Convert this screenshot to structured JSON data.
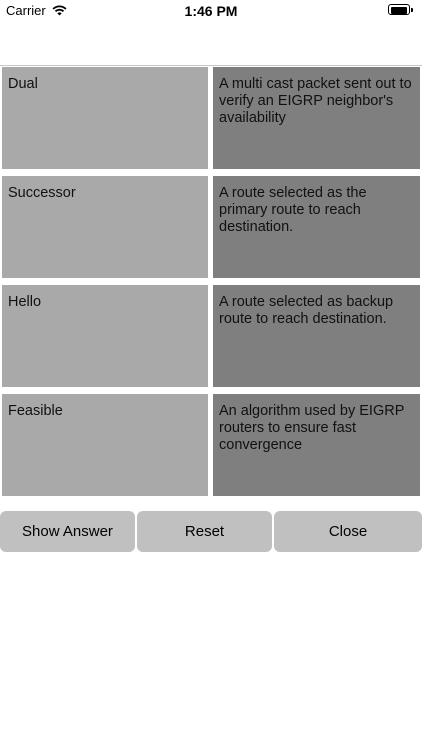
{
  "status_bar": {
    "carrier": "Carrier",
    "time": "1:46 PM"
  },
  "rows": [
    {
      "term": "Dual",
      "definition": "A multi cast packet sent out to verify an EIGRP neighbor's availability"
    },
    {
      "term": "Successor",
      "definition": "A route selected as the primary route to reach destination."
    },
    {
      "term": "Hello",
      "definition": "A route selected as backup route to reach destination."
    },
    {
      "term": "Feasible",
      "definition": "An algorithm used by EIGRP routers to ensure fast convergence"
    }
  ],
  "buttons": {
    "show_answer": "Show Answer",
    "reset": "Reset",
    "close": "Close"
  },
  "colors": {
    "term_bg": "#a9a9a9",
    "definition_bg": "#7f7f7f",
    "button_bg": "#c0c0c0"
  }
}
